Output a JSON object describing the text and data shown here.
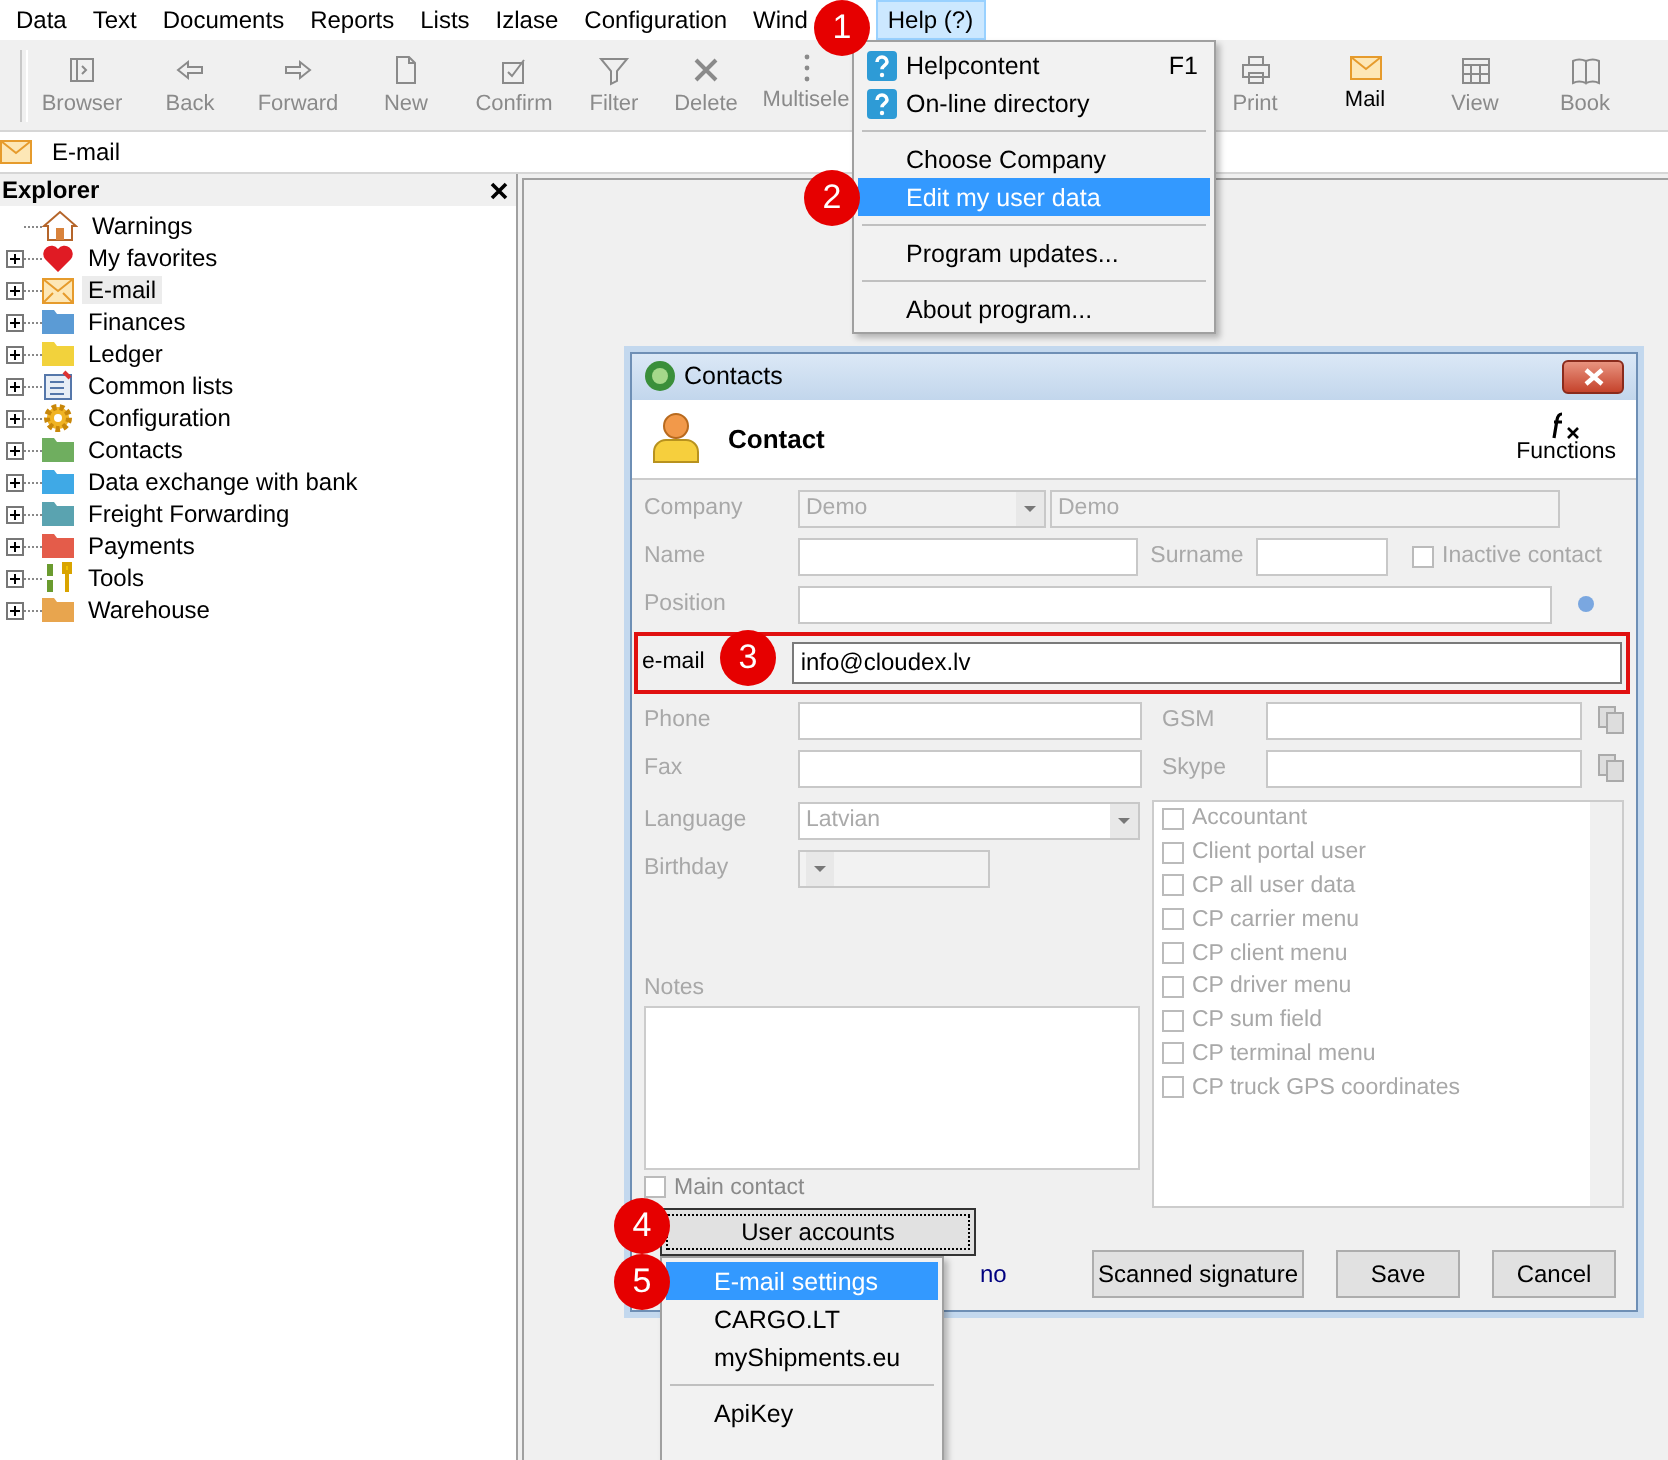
{
  "menu_bar": [
    {
      "label": "Data",
      "selected": false
    },
    {
      "label": "Text",
      "selected": false
    },
    {
      "label": "Documents",
      "selected": false
    },
    {
      "label": "Reports",
      "selected": false
    },
    {
      "label": "Lists",
      "selected": false
    },
    {
      "label": "Izlase",
      "selected": false
    },
    {
      "label": "Configuration",
      "selected": false
    },
    {
      "label": "Wind",
      "selected": false
    },
    {
      "label": "Help (?)",
      "selected": true
    }
  ],
  "toolbar": {
    "left": [
      {
        "kind": "browser",
        "label": "Browser",
        "disabled": true
      },
      {
        "kind": "back",
        "label": "Back",
        "disabled": true
      },
      {
        "kind": "forward",
        "label": "Forward",
        "disabled": true
      },
      {
        "kind": "new",
        "label": "New",
        "disabled": true
      },
      {
        "kind": "confirm",
        "label": "Confirm",
        "disabled": true
      },
      {
        "kind": "filter",
        "label": "Filter",
        "disabled": true
      },
      {
        "kind": "delete",
        "label": "Delete",
        "disabled": true
      },
      {
        "kind": "more",
        "label": "Multisele",
        "disabled": true
      }
    ],
    "right": [
      {
        "kind": "print",
        "label": "Print",
        "disabled": true
      },
      {
        "kind": "mail",
        "label": "Mail",
        "disabled": false
      },
      {
        "kind": "view",
        "label": "View",
        "disabled": true
      },
      {
        "kind": "book",
        "label": "Book",
        "disabled": true
      }
    ]
  },
  "breadcrumb": "E-mail",
  "explorer": {
    "title": "Explorer",
    "items": [
      {
        "kind": "house",
        "label": "Warnings",
        "expandable": false,
        "selected": false
      },
      {
        "kind": "heart",
        "label": "My favorites",
        "expandable": true,
        "selected": false
      },
      {
        "kind": "envelope",
        "label": "E-mail",
        "expandable": true,
        "selected": true
      },
      {
        "kind": "folder",
        "color": "#5b9bd5",
        "label": "Finances",
        "expandable": true,
        "selected": false
      },
      {
        "kind": "folder",
        "color": "#f2d23c",
        "label": "Ledger",
        "expandable": true,
        "selected": false
      },
      {
        "kind": "list",
        "label": "Common lists",
        "expandable": true,
        "selected": false
      },
      {
        "kind": "gear",
        "label": "Configuration",
        "expandable": true,
        "selected": false
      },
      {
        "kind": "folder",
        "color": "#6fae5f",
        "label": "Contacts",
        "expandable": true,
        "selected": false
      },
      {
        "kind": "folder",
        "color": "#3fa9e6",
        "label": "Data exchange with bank",
        "expandable": true,
        "selected": false
      },
      {
        "kind": "folder",
        "color": "#5aa3b0",
        "label": "Freight Forwarding",
        "expandable": true,
        "selected": false
      },
      {
        "kind": "folder",
        "color": "#e45c4a",
        "label": "Payments",
        "expandable": true,
        "selected": false
      },
      {
        "kind": "tools",
        "label": "Tools",
        "expandable": true,
        "selected": false
      },
      {
        "kind": "folder",
        "color": "#e8a54e",
        "label": "Warehouse",
        "expandable": true,
        "selected": false
      }
    ]
  },
  "help_menu": [
    {
      "kind": "help",
      "label": "Helpcontent",
      "shortcut": "F1",
      "selected": false
    },
    {
      "kind": "help",
      "label": "On-line directory",
      "selected": false
    },
    {
      "kind": "separator"
    },
    {
      "kind": "item",
      "label": "Choose Company",
      "selected": false
    },
    {
      "kind": "item",
      "label": "Edit my user data",
      "selected": true
    },
    {
      "kind": "separator"
    },
    {
      "kind": "item",
      "label": "Program updates...",
      "selected": false
    },
    {
      "kind": "separator"
    },
    {
      "kind": "item",
      "label": "About program...",
      "selected": false
    }
  ],
  "dialog": {
    "title": "Contacts",
    "header": "Contact",
    "functions": "Functions",
    "form": {
      "company": {
        "label": "Company",
        "code": "Demo",
        "name": "Demo"
      },
      "name": {
        "label": "Name"
      },
      "surname": {
        "label": "Surname"
      },
      "inactive": {
        "label": "Inactive contact",
        "checked": false
      },
      "position": {
        "label": "Position"
      },
      "email": {
        "label": "e-mail",
        "value": "info@cloudex.lv"
      },
      "phone": {
        "label": "Phone"
      },
      "gsm": {
        "label": "GSM"
      },
      "fax": {
        "label": "Fax"
      },
      "skype": {
        "label": "Skype"
      },
      "language": {
        "label": "Language",
        "value": "Latvian"
      },
      "birthday": {
        "label": "Birthday"
      },
      "notes": {
        "label": "Notes"
      },
      "main_contact": {
        "label": "Main contact",
        "checked": false
      }
    },
    "roles": [
      {
        "label": "Accountant",
        "checked": false
      },
      {
        "label": "Client portal user",
        "checked": false
      },
      {
        "label": "CP all user data",
        "checked": false
      },
      {
        "label": "CP carrier menu",
        "checked": false
      },
      {
        "label": "CP client menu",
        "checked": false
      },
      {
        "label": "CP driver menu",
        "checked": false
      },
      {
        "label": "CP sum field",
        "checked": false
      },
      {
        "label": "CP terminal menu",
        "checked": false
      },
      {
        "label": "CP truck GPS coordinates",
        "checked": false
      }
    ],
    "link_tail": "no",
    "buttons": [
      {
        "label": "User accounts",
        "focused": true
      },
      {
        "label": "Scanned signature",
        "focused": false
      },
      {
        "label": "Save",
        "focused": false
      },
      {
        "label": "Cancel",
        "focused": false
      }
    ]
  },
  "popup_menu": [
    {
      "kind": "item",
      "label": "E-mail settings",
      "selected": true
    },
    {
      "kind": "item",
      "label": "CARGO.LT",
      "selected": false
    },
    {
      "kind": "item",
      "label": "myShipments.eu",
      "selected": false
    },
    {
      "kind": "separator"
    },
    {
      "kind": "item",
      "label": "ApiKey",
      "selected": false
    }
  ],
  "callouts": [
    "1",
    "2",
    "3",
    "4",
    "5"
  ]
}
